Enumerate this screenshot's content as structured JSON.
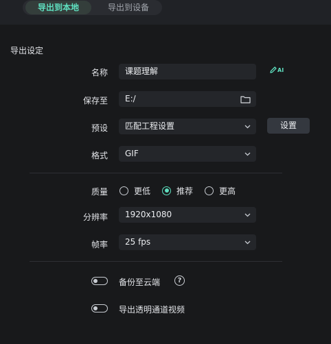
{
  "tabs": {
    "local": "导出到本地",
    "device": "导出到设备"
  },
  "section_title": "导出设定",
  "fields": {
    "name": {
      "label": "名称",
      "value": "课题理解"
    },
    "save_to": {
      "label": "保存至",
      "value": "E:/"
    },
    "preset": {
      "label": "预设",
      "value": "匹配工程设置",
      "button": "设置"
    },
    "format": {
      "label": "格式",
      "value": "GIF"
    },
    "quality": {
      "label": "质量",
      "options": [
        "更低",
        "推荐",
        "更高"
      ],
      "selected": "推荐"
    },
    "resolution": {
      "label": "分辨率",
      "value": "1920x1080"
    },
    "framerate": {
      "label": "帧率",
      "value": "25 fps"
    }
  },
  "toggles": {
    "cloud_backup": {
      "label": "备份至云端",
      "on": false
    },
    "transparent_channel": {
      "label": "导出透明通道视频",
      "on": false
    }
  },
  "icons": {
    "ai_rename": "AI",
    "help": "?"
  },
  "colors": {
    "accent": "#5fe0c0",
    "background": "#18191b",
    "field": "#24262a"
  }
}
